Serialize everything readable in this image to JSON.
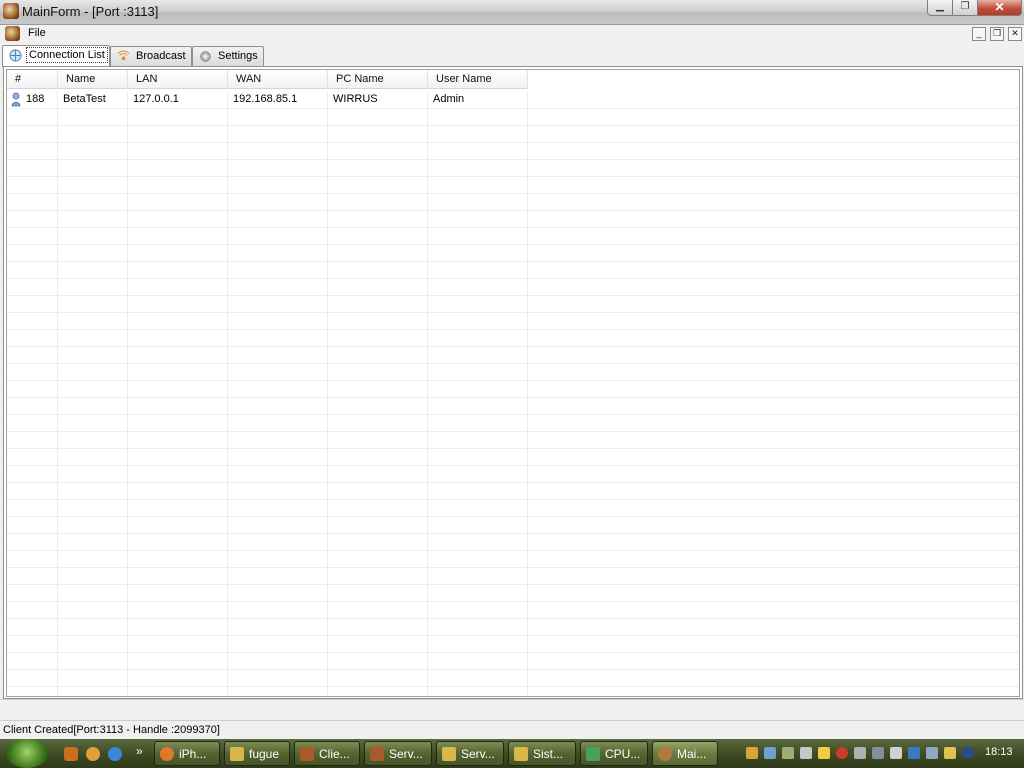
{
  "window": {
    "title": "MainForm - [Port :3113]"
  },
  "menu": {
    "file": "File"
  },
  "tabs": [
    {
      "label": "Connection List"
    },
    {
      "label": "Broadcast"
    },
    {
      "label": "Settings"
    }
  ],
  "table": {
    "headers": [
      "#",
      "Name",
      "LAN",
      "WAN",
      "PC Name",
      "User Name"
    ],
    "rows": [
      {
        "id": "188",
        "name": "BetaTest",
        "lan": "127.0.0.1",
        "wan": "192.168.85.1",
        "pc_name": "WIRRUS",
        "user_name": "Admin"
      }
    ]
  },
  "status": {
    "text": "Client Created[Port:3113 - Handle :2099370]"
  },
  "taskbar": {
    "quick_launch_more": "»",
    "tasks": [
      "iPh...",
      "fugue",
      "Clie...",
      "Serv...",
      "Serv...",
      "Sist...",
      "CPU...",
      "Mai..."
    ],
    "clock": "18:13"
  },
  "colors": {
    "titlebar": "#c9c9c9",
    "taskbar": "#3f4b24",
    "grid_line": "#ececec"
  }
}
